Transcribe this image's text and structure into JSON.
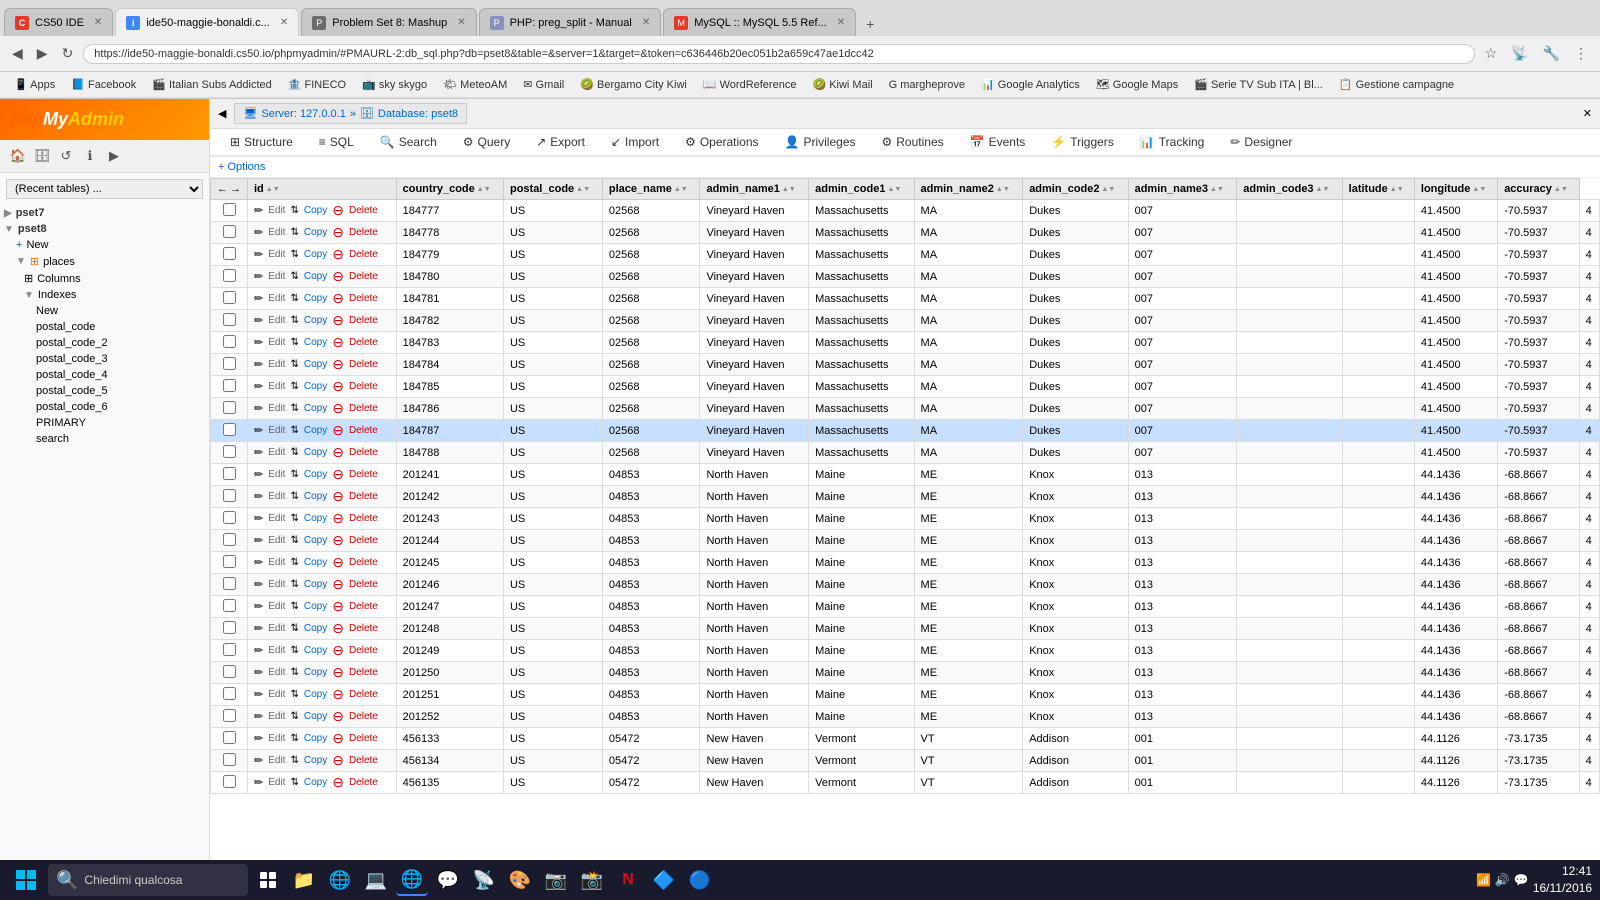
{
  "browser": {
    "tabs": [
      {
        "id": "cs50ide",
        "label": "CS50 IDE",
        "favicon_color": "#e8372a",
        "favicon_letter": "C",
        "active": false
      },
      {
        "id": "ide50",
        "label": "ide50-maggie-bonaldi.c...",
        "favicon_color": "#4285f4",
        "favicon_letter": "i",
        "active": true
      },
      {
        "id": "pset8",
        "label": "Problem Set 8: Mashup",
        "favicon_color": "#6c6c6c",
        "favicon_letter": "P",
        "active": false
      },
      {
        "id": "php",
        "label": "PHP: preg_split - Manual",
        "favicon_color": "#8892be",
        "favicon_letter": "P",
        "active": false
      },
      {
        "id": "mysql",
        "label": "MySQL :: MySQL 5.5 Ref...",
        "favicon_color": "#e8372a",
        "favicon_letter": "M",
        "active": false
      }
    ],
    "url": "https://ide50-maggie-bonaldi.cs50.io/phpmyadmin/#PMAURL-2:db_sql.php?db=pset8&table=&server=1&target=&token=c636446b20ec051b2a659c47ae1dcc42",
    "bookmarks": [
      {
        "label": "Apps"
      },
      {
        "label": "Facebook"
      },
      {
        "label": "Italian Subs Addicted"
      },
      {
        "label": "FINECO"
      },
      {
        "label": "sky skygo"
      },
      {
        "label": "MeteoAM"
      },
      {
        "label": "Gmail"
      },
      {
        "label": "Bergamo City Kiwi"
      },
      {
        "label": "WordReference"
      },
      {
        "label": "Kiwi Mail"
      },
      {
        "label": "margheprove"
      },
      {
        "label": "Google Analytics"
      },
      {
        "label": "Google Maps"
      },
      {
        "label": "Serie TV Sub ITA | Bl..."
      },
      {
        "label": "Gestione campagne"
      }
    ]
  },
  "pma": {
    "logo": "phpMyAdmin",
    "server": "Server: 127.0.0.1",
    "database": "Database: pset8",
    "sidebar": {
      "db_selector_placeholder": "(Recent tables) ...",
      "tree": [
        {
          "level": "db",
          "label": "pset7",
          "expanded": false
        },
        {
          "level": "db",
          "label": "pset8",
          "expanded": true
        },
        {
          "level": "table",
          "label": "New"
        },
        {
          "level": "table-expanded",
          "label": "places",
          "expanded": true
        },
        {
          "level": "sub",
          "label": "Columns"
        },
        {
          "level": "sub",
          "label": "Indexes",
          "expanded": true
        },
        {
          "level": "subsub",
          "label": "New"
        },
        {
          "level": "subsub",
          "label": "postal_code"
        },
        {
          "level": "subsub",
          "label": "postal_code_2"
        },
        {
          "level": "subsub",
          "label": "postal_code_3"
        },
        {
          "level": "subsub",
          "label": "postal_code_4"
        },
        {
          "level": "subsub",
          "label": "postal_code_5"
        },
        {
          "level": "subsub",
          "label": "postal_code_6"
        },
        {
          "level": "subsub",
          "label": "PRIMARY"
        },
        {
          "level": "subsub",
          "label": "search"
        }
      ]
    },
    "nav_tabs": [
      {
        "label": "Structure",
        "icon": "⊞"
      },
      {
        "label": "SQL",
        "icon": "≡"
      },
      {
        "label": "Search",
        "icon": "🔍"
      },
      {
        "label": "Query",
        "icon": "⚙"
      },
      {
        "label": "Export",
        "icon": "↗"
      },
      {
        "label": "Import",
        "icon": "↙"
      },
      {
        "label": "Operations",
        "icon": "⚙"
      },
      {
        "label": "Privileges",
        "icon": "👤"
      },
      {
        "label": "Routines",
        "icon": "⚙"
      },
      {
        "label": "Events",
        "icon": "📅"
      },
      {
        "label": "Triggers",
        "icon": "⚡"
      },
      {
        "label": "Tracking",
        "icon": "📊"
      },
      {
        "label": "Designer",
        "icon": "✏"
      }
    ],
    "options_label": "+ Options",
    "columns": [
      {
        "name": "id"
      },
      {
        "name": "country_code"
      },
      {
        "name": "postal_code"
      },
      {
        "name": "place_name"
      },
      {
        "name": "admin_name1"
      },
      {
        "name": "admin_code1"
      },
      {
        "name": "admin_name2"
      },
      {
        "name": "admin_code2"
      },
      {
        "name": "admin_name3"
      },
      {
        "name": "admin_code3"
      },
      {
        "name": "latitude"
      },
      {
        "name": "longitude"
      },
      {
        "name": "accuracy"
      }
    ],
    "rows": [
      {
        "id": "184777",
        "country_code": "US",
        "postal_code": "02568",
        "place_name": "Vineyard Haven",
        "admin_name1": "Massachusetts",
        "admin_code1": "MA",
        "admin_name2": "Dukes",
        "admin_code2": "007",
        "admin_name3": "",
        "admin_code3": "",
        "latitude": "41.4500",
        "longitude": "-70.5937",
        "accuracy": "4"
      },
      {
        "id": "184778",
        "country_code": "US",
        "postal_code": "02568",
        "place_name": "Vineyard Haven",
        "admin_name1": "Massachusetts",
        "admin_code1": "MA",
        "admin_name2": "Dukes",
        "admin_code2": "007",
        "admin_name3": "",
        "admin_code3": "",
        "latitude": "41.4500",
        "longitude": "-70.5937",
        "accuracy": "4"
      },
      {
        "id": "184779",
        "country_code": "US",
        "postal_code": "02568",
        "place_name": "Vineyard Haven",
        "admin_name1": "Massachusetts",
        "admin_code1": "MA",
        "admin_name2": "Dukes",
        "admin_code2": "007",
        "admin_name3": "",
        "admin_code3": "",
        "latitude": "41.4500",
        "longitude": "-70.5937",
        "accuracy": "4"
      },
      {
        "id": "184780",
        "country_code": "US",
        "postal_code": "02568",
        "place_name": "Vineyard Haven",
        "admin_name1": "Massachusetts",
        "admin_code1": "MA",
        "admin_name2": "Dukes",
        "admin_code2": "007",
        "admin_name3": "",
        "admin_code3": "",
        "latitude": "41.4500",
        "longitude": "-70.5937",
        "accuracy": "4"
      },
      {
        "id": "184781",
        "country_code": "US",
        "postal_code": "02568",
        "place_name": "Vineyard Haven",
        "admin_name1": "Massachusetts",
        "admin_code1": "MA",
        "admin_name2": "Dukes",
        "admin_code2": "007",
        "admin_name3": "",
        "admin_code3": "",
        "latitude": "41.4500",
        "longitude": "-70.5937",
        "accuracy": "4"
      },
      {
        "id": "184782",
        "country_code": "US",
        "postal_code": "02568",
        "place_name": "Vineyard Haven",
        "admin_name1": "Massachusetts",
        "admin_code1": "MA",
        "admin_name2": "Dukes",
        "admin_code2": "007",
        "admin_name3": "",
        "admin_code3": "",
        "latitude": "41.4500",
        "longitude": "-70.5937",
        "accuracy": "4"
      },
      {
        "id": "184783",
        "country_code": "US",
        "postal_code": "02568",
        "place_name": "Vineyard Haven",
        "admin_name1": "Massachusetts",
        "admin_code1": "MA",
        "admin_name2": "Dukes",
        "admin_code2": "007",
        "admin_name3": "",
        "admin_code3": "",
        "latitude": "41.4500",
        "longitude": "-70.5937",
        "accuracy": "4"
      },
      {
        "id": "184784",
        "country_code": "US",
        "postal_code": "02568",
        "place_name": "Vineyard Haven",
        "admin_name1": "Massachusetts",
        "admin_code1": "MA",
        "admin_name2": "Dukes",
        "admin_code2": "007",
        "admin_name3": "",
        "admin_code3": "",
        "latitude": "41.4500",
        "longitude": "-70.5937",
        "accuracy": "4"
      },
      {
        "id": "184785",
        "country_code": "US",
        "postal_code": "02568",
        "place_name": "Vineyard Haven",
        "admin_name1": "Massachusetts",
        "admin_code1": "MA",
        "admin_name2": "Dukes",
        "admin_code2": "007",
        "admin_name3": "",
        "admin_code3": "",
        "latitude": "41.4500",
        "longitude": "-70.5937",
        "accuracy": "4"
      },
      {
        "id": "184786",
        "country_code": "US",
        "postal_code": "02568",
        "place_name": "Vineyard Haven",
        "admin_name1": "Massachusetts",
        "admin_code1": "MA",
        "admin_name2": "Dukes",
        "admin_code2": "007",
        "admin_name3": "",
        "admin_code3": "",
        "latitude": "41.4500",
        "longitude": "-70.5937",
        "accuracy": "4"
      },
      {
        "id": "184787",
        "country_code": "US",
        "postal_code": "02568",
        "place_name": "Vineyard Haven",
        "admin_name1": "Massachusetts",
        "admin_code1": "MA",
        "admin_name2": "Dukes",
        "admin_code2": "007",
        "admin_name3": "",
        "admin_code3": "",
        "latitude": "41.4500",
        "longitude": "-70.5937",
        "accuracy": "4",
        "highlighted": true
      },
      {
        "id": "184788",
        "country_code": "US",
        "postal_code": "02568",
        "place_name": "Vineyard Haven",
        "admin_name1": "Massachusetts",
        "admin_code1": "MA",
        "admin_name2": "Dukes",
        "admin_code2": "007",
        "admin_name3": "",
        "admin_code3": "",
        "latitude": "41.4500",
        "longitude": "-70.5937",
        "accuracy": "4"
      },
      {
        "id": "201241",
        "country_code": "US",
        "postal_code": "04853",
        "place_name": "North Haven",
        "admin_name1": "Maine",
        "admin_code1": "ME",
        "admin_name2": "Knox",
        "admin_code2": "013",
        "admin_name3": "",
        "admin_code3": "",
        "latitude": "44.1436",
        "longitude": "-68.8667",
        "accuracy": "4"
      },
      {
        "id": "201242",
        "country_code": "US",
        "postal_code": "04853",
        "place_name": "North Haven",
        "admin_name1": "Maine",
        "admin_code1": "ME",
        "admin_name2": "Knox",
        "admin_code2": "013",
        "admin_name3": "",
        "admin_code3": "",
        "latitude": "44.1436",
        "longitude": "-68.8667",
        "accuracy": "4"
      },
      {
        "id": "201243",
        "country_code": "US",
        "postal_code": "04853",
        "place_name": "North Haven",
        "admin_name1": "Maine",
        "admin_code1": "ME",
        "admin_name2": "Knox",
        "admin_code2": "013",
        "admin_name3": "",
        "admin_code3": "",
        "latitude": "44.1436",
        "longitude": "-68.8667",
        "accuracy": "4"
      },
      {
        "id": "201244",
        "country_code": "US",
        "postal_code": "04853",
        "place_name": "North Haven",
        "admin_name1": "Maine",
        "admin_code1": "ME",
        "admin_name2": "Knox",
        "admin_code2": "013",
        "admin_name3": "",
        "admin_code3": "",
        "latitude": "44.1436",
        "longitude": "-68.8667",
        "accuracy": "4"
      },
      {
        "id": "201245",
        "country_code": "US",
        "postal_code": "04853",
        "place_name": "North Haven",
        "admin_name1": "Maine",
        "admin_code1": "ME",
        "admin_name2": "Knox",
        "admin_code2": "013",
        "admin_name3": "",
        "admin_code3": "",
        "latitude": "44.1436",
        "longitude": "-68.8667",
        "accuracy": "4"
      },
      {
        "id": "201246",
        "country_code": "US",
        "postal_code": "04853",
        "place_name": "North Haven",
        "admin_name1": "Maine",
        "admin_code1": "ME",
        "admin_name2": "Knox",
        "admin_code2": "013",
        "admin_name3": "",
        "admin_code3": "",
        "latitude": "44.1436",
        "longitude": "-68.8667",
        "accuracy": "4"
      },
      {
        "id": "201247",
        "country_code": "US",
        "postal_code": "04853",
        "place_name": "North Haven",
        "admin_name1": "Maine",
        "admin_code1": "ME",
        "admin_name2": "Knox",
        "admin_code2": "013",
        "admin_name3": "",
        "admin_code3": "",
        "latitude": "44.1436",
        "longitude": "-68.8667",
        "accuracy": "4"
      },
      {
        "id": "201248",
        "country_code": "US",
        "postal_code": "04853",
        "place_name": "North Haven",
        "admin_name1": "Maine",
        "admin_code1": "ME",
        "admin_name2": "Knox",
        "admin_code2": "013",
        "admin_name3": "",
        "admin_code3": "",
        "latitude": "44.1436",
        "longitude": "-68.8667",
        "accuracy": "4"
      },
      {
        "id": "201249",
        "country_code": "US",
        "postal_code": "04853",
        "place_name": "North Haven",
        "admin_name1": "Maine",
        "admin_code1": "ME",
        "admin_name2": "Knox",
        "admin_code2": "013",
        "admin_name3": "",
        "admin_code3": "",
        "latitude": "44.1436",
        "longitude": "-68.8667",
        "accuracy": "4"
      },
      {
        "id": "201250",
        "country_code": "US",
        "postal_code": "04853",
        "place_name": "North Haven",
        "admin_name1": "Maine",
        "admin_code1": "ME",
        "admin_name2": "Knox",
        "admin_code2": "013",
        "admin_name3": "",
        "admin_code3": "",
        "latitude": "44.1436",
        "longitude": "-68.8667",
        "accuracy": "4"
      },
      {
        "id": "201251",
        "country_code": "US",
        "postal_code": "04853",
        "place_name": "North Haven",
        "admin_name1": "Maine",
        "admin_code1": "ME",
        "admin_name2": "Knox",
        "admin_code2": "013",
        "admin_name3": "",
        "admin_code3": "",
        "latitude": "44.1436",
        "longitude": "-68.8667",
        "accuracy": "4"
      },
      {
        "id": "201252",
        "country_code": "US",
        "postal_code": "04853",
        "place_name": "North Haven",
        "admin_name1": "Maine",
        "admin_code1": "ME",
        "admin_name2": "Knox",
        "admin_code2": "013",
        "admin_name3": "",
        "admin_code3": "",
        "latitude": "44.1436",
        "longitude": "-68.8667",
        "accuracy": "4"
      },
      {
        "id": "456133",
        "country_code": "US",
        "postal_code": "05472",
        "place_name": "New Haven",
        "admin_name1": "Vermont",
        "admin_code1": "VT",
        "admin_name2": "Addison",
        "admin_code2": "001",
        "admin_name3": "",
        "admin_code3": "",
        "latitude": "44.1126",
        "longitude": "-73.1735",
        "accuracy": "4"
      },
      {
        "id": "456134",
        "country_code": "US",
        "postal_code": "05472",
        "place_name": "New Haven",
        "admin_name1": "Vermont",
        "admin_code1": "VT",
        "admin_name2": "Addison",
        "admin_code2": "001",
        "admin_name3": "",
        "admin_code3": "",
        "latitude": "44.1126",
        "longitude": "-73.1735",
        "accuracy": "4"
      },
      {
        "id": "456135",
        "country_code": "US",
        "postal_code": "05472",
        "place_name": "New Haven",
        "admin_name1": "Vermont",
        "admin_code1": "VT",
        "admin_name2": "Addison",
        "admin_code2": "001",
        "admin_name3": "",
        "admin_code3": "",
        "latitude": "44.1126",
        "longitude": "-73.1735",
        "accuracy": "4"
      }
    ]
  },
  "taskbar": {
    "time": "12:41",
    "date": "16/11/2016",
    "search_placeholder": "Chiedimi qualcosa"
  }
}
